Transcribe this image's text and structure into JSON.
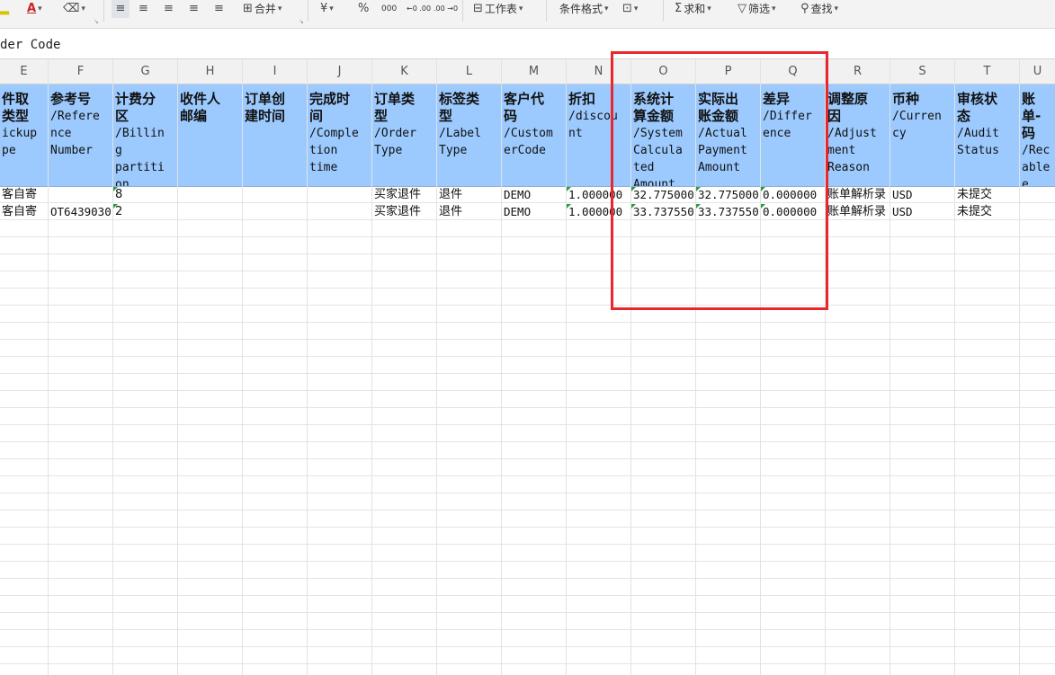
{
  "toolbar": {
    "font_color_label": "A",
    "align_labels": [
      "≡",
      "≡",
      "≡",
      "≡",
      "≡"
    ],
    "merge_label": "合并",
    "currency_label": "¥",
    "percent_label": "%",
    "thousands_label": "000",
    "dec_inc_label": "←0 .00",
    "dec_dec_label": ".00 →0",
    "sheet_label": "工作表",
    "cond_format_label": "条件格式",
    "sum_label": "求和",
    "filter_label": "筛选",
    "find_label": "查找"
  },
  "formula_bar": {
    "text": "der Code"
  },
  "columns": [
    {
      "letter": "E",
      "cn": "件取\n类型",
      "en": "ickup\npe"
    },
    {
      "letter": "F",
      "cn": "参考号",
      "en": "/Refere\nnce\nNumber"
    },
    {
      "letter": "G",
      "cn": "计费分\n区",
      "en": "/Billin\ng\npartiti\non"
    },
    {
      "letter": "H",
      "cn": "收件人\n邮编",
      "en": ""
    },
    {
      "letter": "I",
      "cn": "订单创\n建时间",
      "en": ""
    },
    {
      "letter": "J",
      "cn": "完成时\n间",
      "en": "/Comple\ntion\ntime"
    },
    {
      "letter": "K",
      "cn": "订单类\n型",
      "en": "/Order\nType"
    },
    {
      "letter": "L",
      "cn": "标签类\n型",
      "en": "/Label\nType"
    },
    {
      "letter": "M",
      "cn": "客户代\n码",
      "en": "/Custom\nerCode"
    },
    {
      "letter": "N",
      "cn": "折扣",
      "en": "/discou\nnt"
    },
    {
      "letter": "O",
      "cn": "系统计\n算金额",
      "en": "/System\nCalcula\nted\nAmount"
    },
    {
      "letter": "P",
      "cn": "实际出\n账金额",
      "en": "/Actual\nPayment\nAmount"
    },
    {
      "letter": "Q",
      "cn": "差异",
      "en": "/Differ\nence"
    },
    {
      "letter": "R",
      "cn": "调整原\n因",
      "en": "/Adjust\nment\nReason"
    },
    {
      "letter": "S",
      "cn": "币种",
      "en": "/Curren\ncy"
    },
    {
      "letter": "T",
      "cn": "审核状\n态",
      "en": "/Audit\nStatus"
    },
    {
      "letter": "U",
      "cn": "账单-\n码",
      "en": "/Rec\nable\ne"
    }
  ],
  "rows": [
    [
      "客自寄",
      "",
      "8",
      "",
      "",
      "",
      "买家退件",
      "退件",
      "DEMO",
      "1.000000",
      "32.775000",
      "32.775000",
      "0.000000",
      "账单解析录",
      "USD",
      "未提交",
      ""
    ],
    [
      "客自寄",
      "OT6439030",
      "2",
      "",
      "",
      "",
      "买家退件",
      "退件",
      "DEMO",
      "1.000000",
      "33.737550",
      "33.737550",
      "0.000000",
      "账单解析录",
      "USD",
      "未提交",
      ""
    ]
  ],
  "colors": {
    "header_fill": "#9ccaff",
    "highlight_border": "#e8282d",
    "number_flag": "#2e9a3e"
  }
}
